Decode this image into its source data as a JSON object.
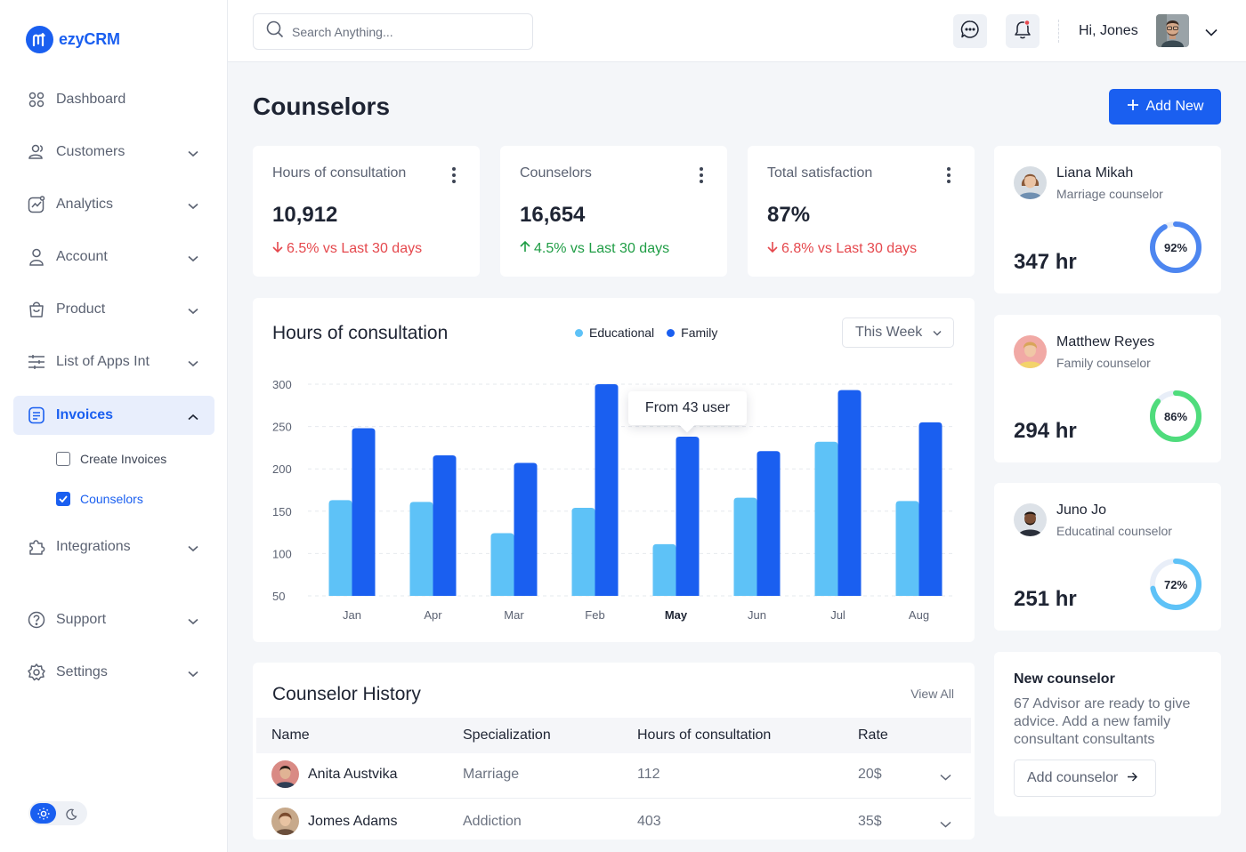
{
  "app": {
    "name": "ezyCRM",
    "brand_color": "#1a5ff0"
  },
  "sidebar": {
    "items": [
      {
        "label": "Dashboard",
        "icon": "grid-icon",
        "has_chevron": false
      },
      {
        "label": "Customers",
        "icon": "users-icon",
        "has_chevron": true
      },
      {
        "label": "Analytics",
        "icon": "analytics-icon",
        "has_chevron": true
      },
      {
        "label": "Account",
        "icon": "user-icon",
        "has_chevron": true
      },
      {
        "label": "Product",
        "icon": "bag-icon",
        "has_chevron": true
      },
      {
        "label": "List of Apps Int",
        "icon": "sliders-icon",
        "has_chevron": true
      },
      {
        "label": "Invoices",
        "icon": "invoice-icon",
        "has_chevron": true,
        "active": true,
        "expanded": true
      },
      {
        "label": "Integrations",
        "icon": "puzzle-icon",
        "has_chevron": true
      },
      {
        "label": "Support",
        "icon": "help-icon",
        "has_chevron": true
      },
      {
        "label": "Settings",
        "icon": "gear-icon",
        "has_chevron": true
      }
    ],
    "sub_items": [
      {
        "label": "Create Invoices",
        "checked": false
      },
      {
        "label": "Counselors",
        "checked": true
      }
    ],
    "theme": "light"
  },
  "topbar": {
    "search_placeholder": "Search Anything...",
    "greeting": "Hi, Jones",
    "notification_dot": true
  },
  "page": {
    "title": "Counselors",
    "add_button": "Add New"
  },
  "stats": [
    {
      "title": "Hours of consultation",
      "value": "10,912",
      "delta": "6.5% vs Last 30 days",
      "direction": "down"
    },
    {
      "title": "Counselors",
      "value": "16,654",
      "delta": "4.5% vs Last 30 days",
      "direction": "up"
    },
    {
      "title": "Total satisfaction",
      "value": "87%",
      "delta": "6.8% vs Last 30 days",
      "direction": "down"
    }
  ],
  "chart_card": {
    "title": "Hours of consultation",
    "period_select": "This Week",
    "tooltip": "From 43 user",
    "highlighted_category": "May"
  },
  "chart_data": {
    "type": "bar",
    "categories": [
      "Jan",
      "Apr",
      "Mar",
      "Feb",
      "May",
      "Jun",
      "Jul",
      "Aug"
    ],
    "series": [
      {
        "name": "Educational",
        "color": "#5ec2f7",
        "values": [
          163,
          161,
          124,
          154,
          111,
          166,
          232,
          162
        ]
      },
      {
        "name": "Family",
        "color": "#1a5ff0",
        "values": [
          248,
          216,
          207,
          300,
          238,
          221,
          293,
          255
        ]
      }
    ],
    "y_ticks": [
      300,
      250,
      200,
      150,
      100,
      50
    ],
    "ylim": [
      50,
      300
    ],
    "grid": true,
    "legend_position": "top"
  },
  "history": {
    "title": "Counselor History",
    "view_all": "View All",
    "columns": [
      "Name",
      "Specialization",
      "Hours of consultation",
      "Rate"
    ],
    "rows": [
      {
        "name": "Anita Austvika",
        "specialization": "Marriage",
        "hours": "112",
        "rate": "20$"
      },
      {
        "name": "Jomes Adams",
        "specialization": "Addiction",
        "hours": "403",
        "rate": "35$"
      }
    ]
  },
  "counselor_cards": [
    {
      "name": "Liana Mikah",
      "role": "Marriage counselor",
      "hours": "347 hr",
      "percent": 92,
      "percent_label": "92%",
      "color": "#4d86f0"
    },
    {
      "name": "Matthew Reyes",
      "role": "Family counselor",
      "hours": "294 hr",
      "percent": 86,
      "percent_label": "86%",
      "color": "#4fdc7c"
    },
    {
      "name": "Juno Jo",
      "role": "Educatinal counselor",
      "hours": "251 hr",
      "percent": 72,
      "percent_label": "72%",
      "color": "#5ec2f7"
    }
  ],
  "new_counselor": {
    "title": "New counselor",
    "text": "67 Advisor are ready to give advice. Add a new family consultant consultants",
    "button": "Add counselor"
  }
}
